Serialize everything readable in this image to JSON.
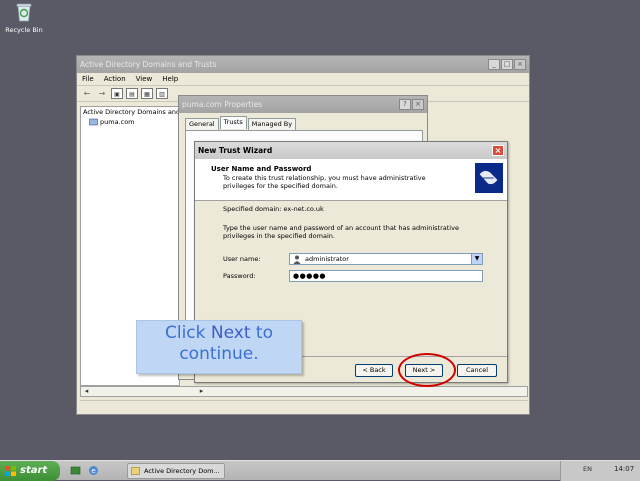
{
  "desktop": {
    "recycle_bin_label": "Recycle Bin"
  },
  "main_window": {
    "title": "Active Directory Domains and Trusts",
    "menu": [
      "File",
      "Action",
      "View",
      "Help"
    ],
    "tree": [
      "Active Directory Domains and Trusts",
      "puma.com"
    ]
  },
  "props_dialog": {
    "title": "puma.com Properties",
    "tabs": [
      "General",
      "Trusts",
      "Managed By"
    ],
    "selected_tab": "Trusts"
  },
  "wizard": {
    "title": "New Trust Wizard",
    "header_title": "User Name and Password",
    "header_desc": "To create this trust relationship, you must have administrative privileges for the specified domain.",
    "specified_domain": "Specified domain: ex-net.co.uk",
    "instructions": "Type the user name and password of an account that has administrative privileges in the specified domain.",
    "username_label": "User name:",
    "username_value": "administrator",
    "password_label": "Password:",
    "password_value": "●●●●●",
    "back_label": "< Back",
    "next_label": "Next >",
    "cancel_label": "Cancel"
  },
  "callout": {
    "prefix": "Click ",
    "button_word": "Next",
    "suffix": " to continue."
  },
  "taskbar": {
    "start_label": "start",
    "task_label": "Active Directory Dom...",
    "language": "EN",
    "clock": "14:07"
  },
  "colors": {
    "desktop_bg": "#5a5a66",
    "callout_text": "#3b6fd1",
    "highlight_ring": "#d10000",
    "start_button": "#4a9c40"
  }
}
